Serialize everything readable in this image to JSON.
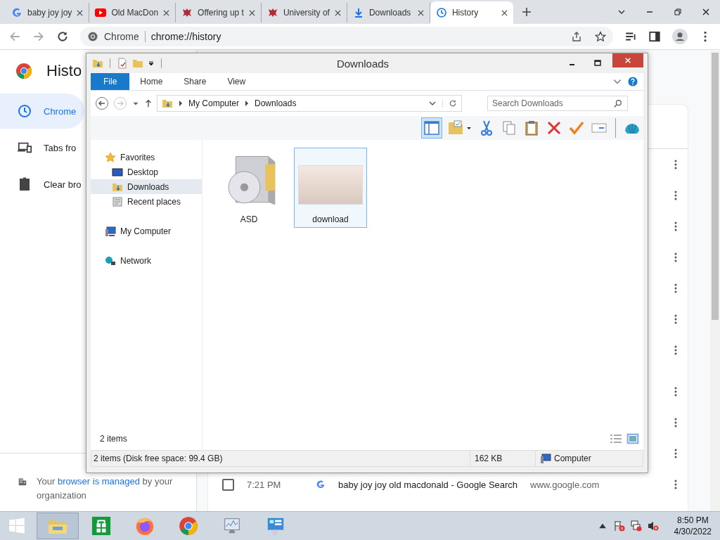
{
  "browser": {
    "tabs": [
      {
        "title": "baby joy joy",
        "selected": false
      },
      {
        "title": "Old MacDon",
        "selected": false
      },
      {
        "title": "Offering up t",
        "selected": false
      },
      {
        "title": "University of",
        "selected": false
      },
      {
        "title": "Downloads",
        "selected": false
      },
      {
        "title": "History",
        "selected": true
      }
    ],
    "omnibox": {
      "site": "Chrome",
      "url": "chrome://history"
    }
  },
  "history_page": {
    "title": "Histo",
    "sidebar": [
      {
        "label": "Chrome",
        "selected": true
      },
      {
        "label": "Tabs fro",
        "selected": false
      },
      {
        "label": "Clear bro",
        "selected": false
      }
    ],
    "managed_notice": {
      "before": "Your",
      "link": "browser is managed",
      "after": "by your organization"
    },
    "rows": [
      {
        "time": "7:21 PM",
        "title": "baby joy joy old macdonald - Google Search",
        "domain": "www.google.com",
        "checked": false
      }
    ]
  },
  "explorer": {
    "title": "Downloads",
    "ribbon_tabs": [
      {
        "label": "File",
        "selected": true
      },
      {
        "label": "Home",
        "selected": false
      },
      {
        "label": "Share",
        "selected": false
      },
      {
        "label": "View",
        "selected": false
      }
    ],
    "breadcrumb": [
      "My Computer",
      "Downloads"
    ],
    "search": {
      "placeholder": "Search Downloads"
    },
    "nav": [
      {
        "label": "Favorites",
        "selected": false,
        "children": [
          {
            "label": "Desktop",
            "selected": false
          },
          {
            "label": "Downloads",
            "selected": true
          },
          {
            "label": "Recent places",
            "selected": false
          }
        ]
      },
      {
        "label": "My Computer",
        "selected": false
      },
      {
        "label": "Network",
        "selected": false
      }
    ],
    "items": [
      {
        "name": "ASD",
        "kind": "installer",
        "selected": false
      },
      {
        "name": "download",
        "kind": "image",
        "selected": true
      }
    ],
    "item_count": "2 items",
    "status_bar": {
      "summary": "2 items (Disk free space: 99.4 GB)",
      "size": "162 KB",
      "location": "Computer"
    }
  },
  "taskbar": {
    "apps": [
      {
        "kind": "explorer",
        "selected": true
      },
      {
        "kind": "store",
        "selected": false
      },
      {
        "kind": "firefox",
        "selected": false
      },
      {
        "kind": "chrome",
        "selected": false
      },
      {
        "kind": "monitor",
        "selected": false
      },
      {
        "kind": "control",
        "selected": false
      }
    ],
    "time": "8:50 PM",
    "date": "4/30/2022"
  }
}
